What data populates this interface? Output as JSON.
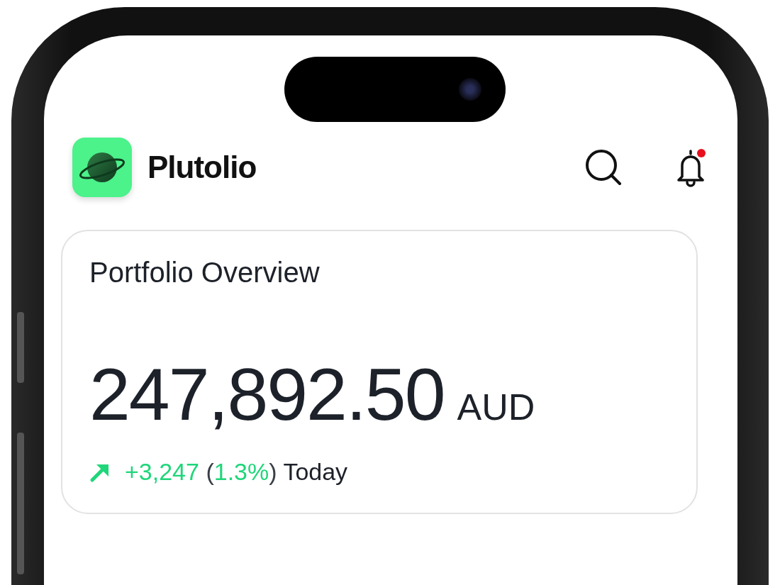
{
  "app": {
    "name": "Plutolio"
  },
  "notifications": {
    "unread": true
  },
  "card": {
    "title": "Portfolio Overview",
    "amount": "247,892.50",
    "currency": "AUD",
    "change": [
      {
        "text": "+3,247 ",
        "kind": "gain"
      },
      {
        "text": "(",
        "kind": "plain"
      },
      {
        "text": "1.3%",
        "kind": "gain"
      },
      {
        "text": ")",
        "kind": "plain"
      },
      {
        "text": " Today",
        "kind": "label"
      }
    ],
    "rising": true
  }
}
